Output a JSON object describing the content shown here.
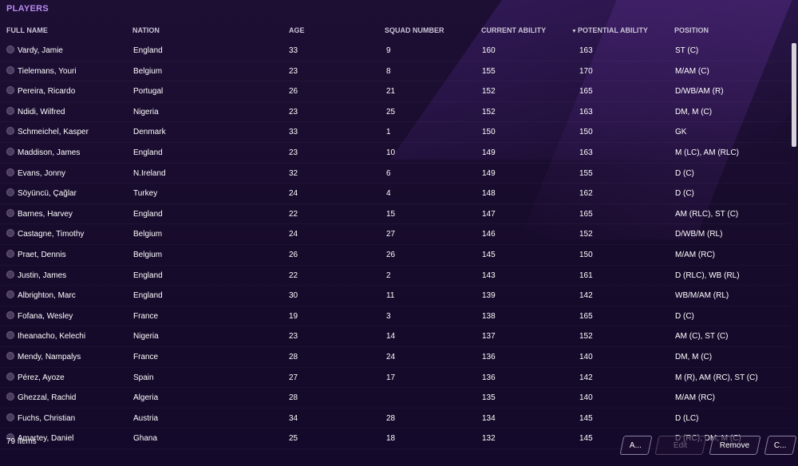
{
  "panel": {
    "title": "PLAYERS"
  },
  "columns": {
    "full_name": "FULL NAME",
    "nation": "NATION",
    "age": "AGE",
    "squad_number": "SQUAD NUMBER",
    "current_ability": "CURRENT ABILITY",
    "potential_ability": "POTENTIAL ABILITY",
    "position": "POSITION"
  },
  "sort_indicator": "▼",
  "players": [
    {
      "name": "Vardy, Jamie",
      "nation": "England",
      "age": "33",
      "squad": "9",
      "ca": "160",
      "pa": "163",
      "pos": "ST (C)"
    },
    {
      "name": "Tielemans, Youri",
      "nation": "Belgium",
      "age": "23",
      "squad": "8",
      "ca": "155",
      "pa": "170",
      "pos": "M/AM (C)"
    },
    {
      "name": "Pereira, Ricardo",
      "nation": "Portugal",
      "age": "26",
      "squad": "21",
      "ca": "152",
      "pa": "165",
      "pos": "D/WB/AM (R)"
    },
    {
      "name": "Ndidi, Wilfred",
      "nation": "Nigeria",
      "age": "23",
      "squad": "25",
      "ca": "152",
      "pa": "163",
      "pos": "DM, M (C)"
    },
    {
      "name": "Schmeichel, Kasper",
      "nation": "Denmark",
      "age": "33",
      "squad": "1",
      "ca": "150",
      "pa": "150",
      "pos": "GK"
    },
    {
      "name": "Maddison, James",
      "nation": "England",
      "age": "23",
      "squad": "10",
      "ca": "149",
      "pa": "163",
      "pos": "M (LC), AM (RLC)"
    },
    {
      "name": "Evans, Jonny",
      "nation": "N.Ireland",
      "age": "32",
      "squad": "6",
      "ca": "149",
      "pa": "155",
      "pos": "D (C)"
    },
    {
      "name": "Söyüncü, Çağlar",
      "nation": "Turkey",
      "age": "24",
      "squad": "4",
      "ca": "148",
      "pa": "162",
      "pos": "D (C)"
    },
    {
      "name": "Barnes, Harvey",
      "nation": "England",
      "age": "22",
      "squad": "15",
      "ca": "147",
      "pa": "165",
      "pos": "AM (RLC), ST (C)"
    },
    {
      "name": "Castagne, Timothy",
      "nation": "Belgium",
      "age": "24",
      "squad": "27",
      "ca": "146",
      "pa": "152",
      "pos": "D/WB/M (RL)"
    },
    {
      "name": "Praet, Dennis",
      "nation": "Belgium",
      "age": "26",
      "squad": "26",
      "ca": "145",
      "pa": "150",
      "pos": "M/AM (RC)"
    },
    {
      "name": "Justin, James",
      "nation": "England",
      "age": "22",
      "squad": "2",
      "ca": "143",
      "pa": "161",
      "pos": "D (RLC), WB (RL)"
    },
    {
      "name": "Albrighton, Marc",
      "nation": "England",
      "age": "30",
      "squad": "11",
      "ca": "139",
      "pa": "142",
      "pos": "WB/M/AM (RL)"
    },
    {
      "name": "Fofana, Wesley",
      "nation": "France",
      "age": "19",
      "squad": "3",
      "ca": "138",
      "pa": "165",
      "pos": "D (C)"
    },
    {
      "name": "Iheanacho, Kelechi",
      "nation": "Nigeria",
      "age": "23",
      "squad": "14",
      "ca": "137",
      "pa": "152",
      "pos": "AM (C), ST (C)"
    },
    {
      "name": "Mendy, Nampalys",
      "nation": "France",
      "age": "28",
      "squad": "24",
      "ca": "136",
      "pa": "140",
      "pos": "DM, M (C)"
    },
    {
      "name": "Pérez, Ayoze",
      "nation": "Spain",
      "age": "27",
      "squad": "17",
      "ca": "136",
      "pa": "142",
      "pos": "M (R), AM (RC), ST (C)"
    },
    {
      "name": "Ghezzal, Rachid",
      "nation": "Algeria",
      "age": "28",
      "squad": "",
      "ca": "135",
      "pa": "140",
      "pos": "M/AM (RC)"
    },
    {
      "name": "Fuchs, Christian",
      "nation": "Austria",
      "age": "34",
      "squad": "28",
      "ca": "134",
      "pa": "145",
      "pos": "D (LC)"
    },
    {
      "name": "Amartey, Daniel",
      "nation": "Ghana",
      "age": "25",
      "squad": "18",
      "ca": "132",
      "pa": "145",
      "pos": "D (RC), DM, M (C)"
    }
  ],
  "footer": {
    "item_count": "79 items",
    "add_label": "A...",
    "edit_label": "Edit",
    "remove_label": "Remove",
    "more_label": "C..."
  }
}
